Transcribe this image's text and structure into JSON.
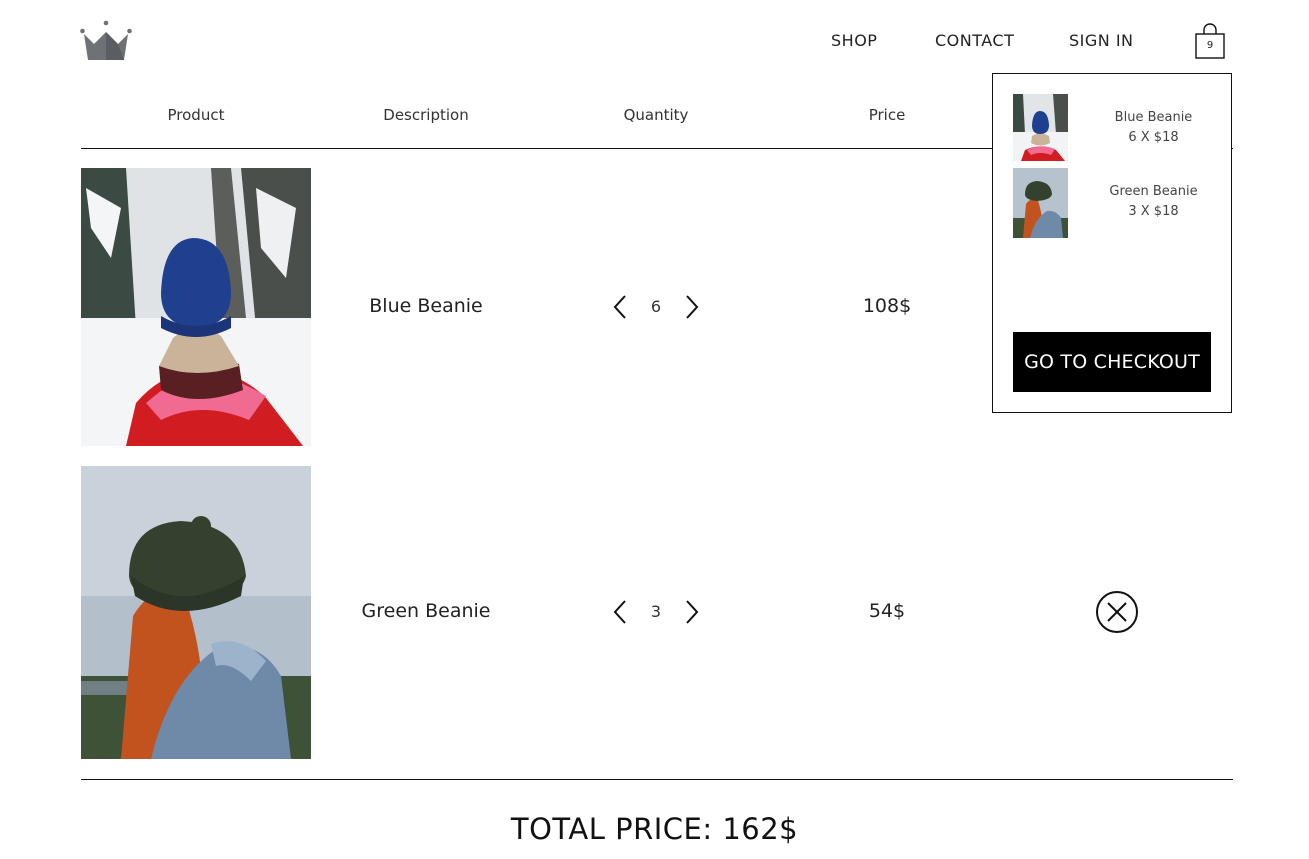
{
  "header": {
    "logo_icon": "crown-icon",
    "nav": [
      {
        "label": "SHOP"
      },
      {
        "label": "CONTACT"
      },
      {
        "label": "SIGN IN"
      }
    ],
    "cart_icon": "shopping-bag-icon",
    "cart_count": "9"
  },
  "table": {
    "columns": [
      "Product",
      "Description",
      "Quantity",
      "Price"
    ]
  },
  "cart": {
    "items": [
      {
        "name": "Blue Beanie",
        "quantity": "6",
        "price": "108$",
        "dropdown_line": "6 X $18",
        "image": "person-in-blue-beanie-snowy-forest-photo"
      },
      {
        "name": "Green Beanie",
        "quantity": "3",
        "price": "54$",
        "dropdown_line": "3 X $18",
        "image": "red-haired-person-in-green-beanie-photo"
      }
    ],
    "total": "TOTAL PRICE: 162$",
    "checkout_label": "GO TO CHECKOUT"
  },
  "icons": {
    "decrease": "chevron-left-icon",
    "increase": "chevron-right-icon",
    "remove": "close-circle-icon"
  },
  "colors": {
    "text": "#111111",
    "checkout_bg": "#000000",
    "checkout_text": "#ffffff"
  }
}
